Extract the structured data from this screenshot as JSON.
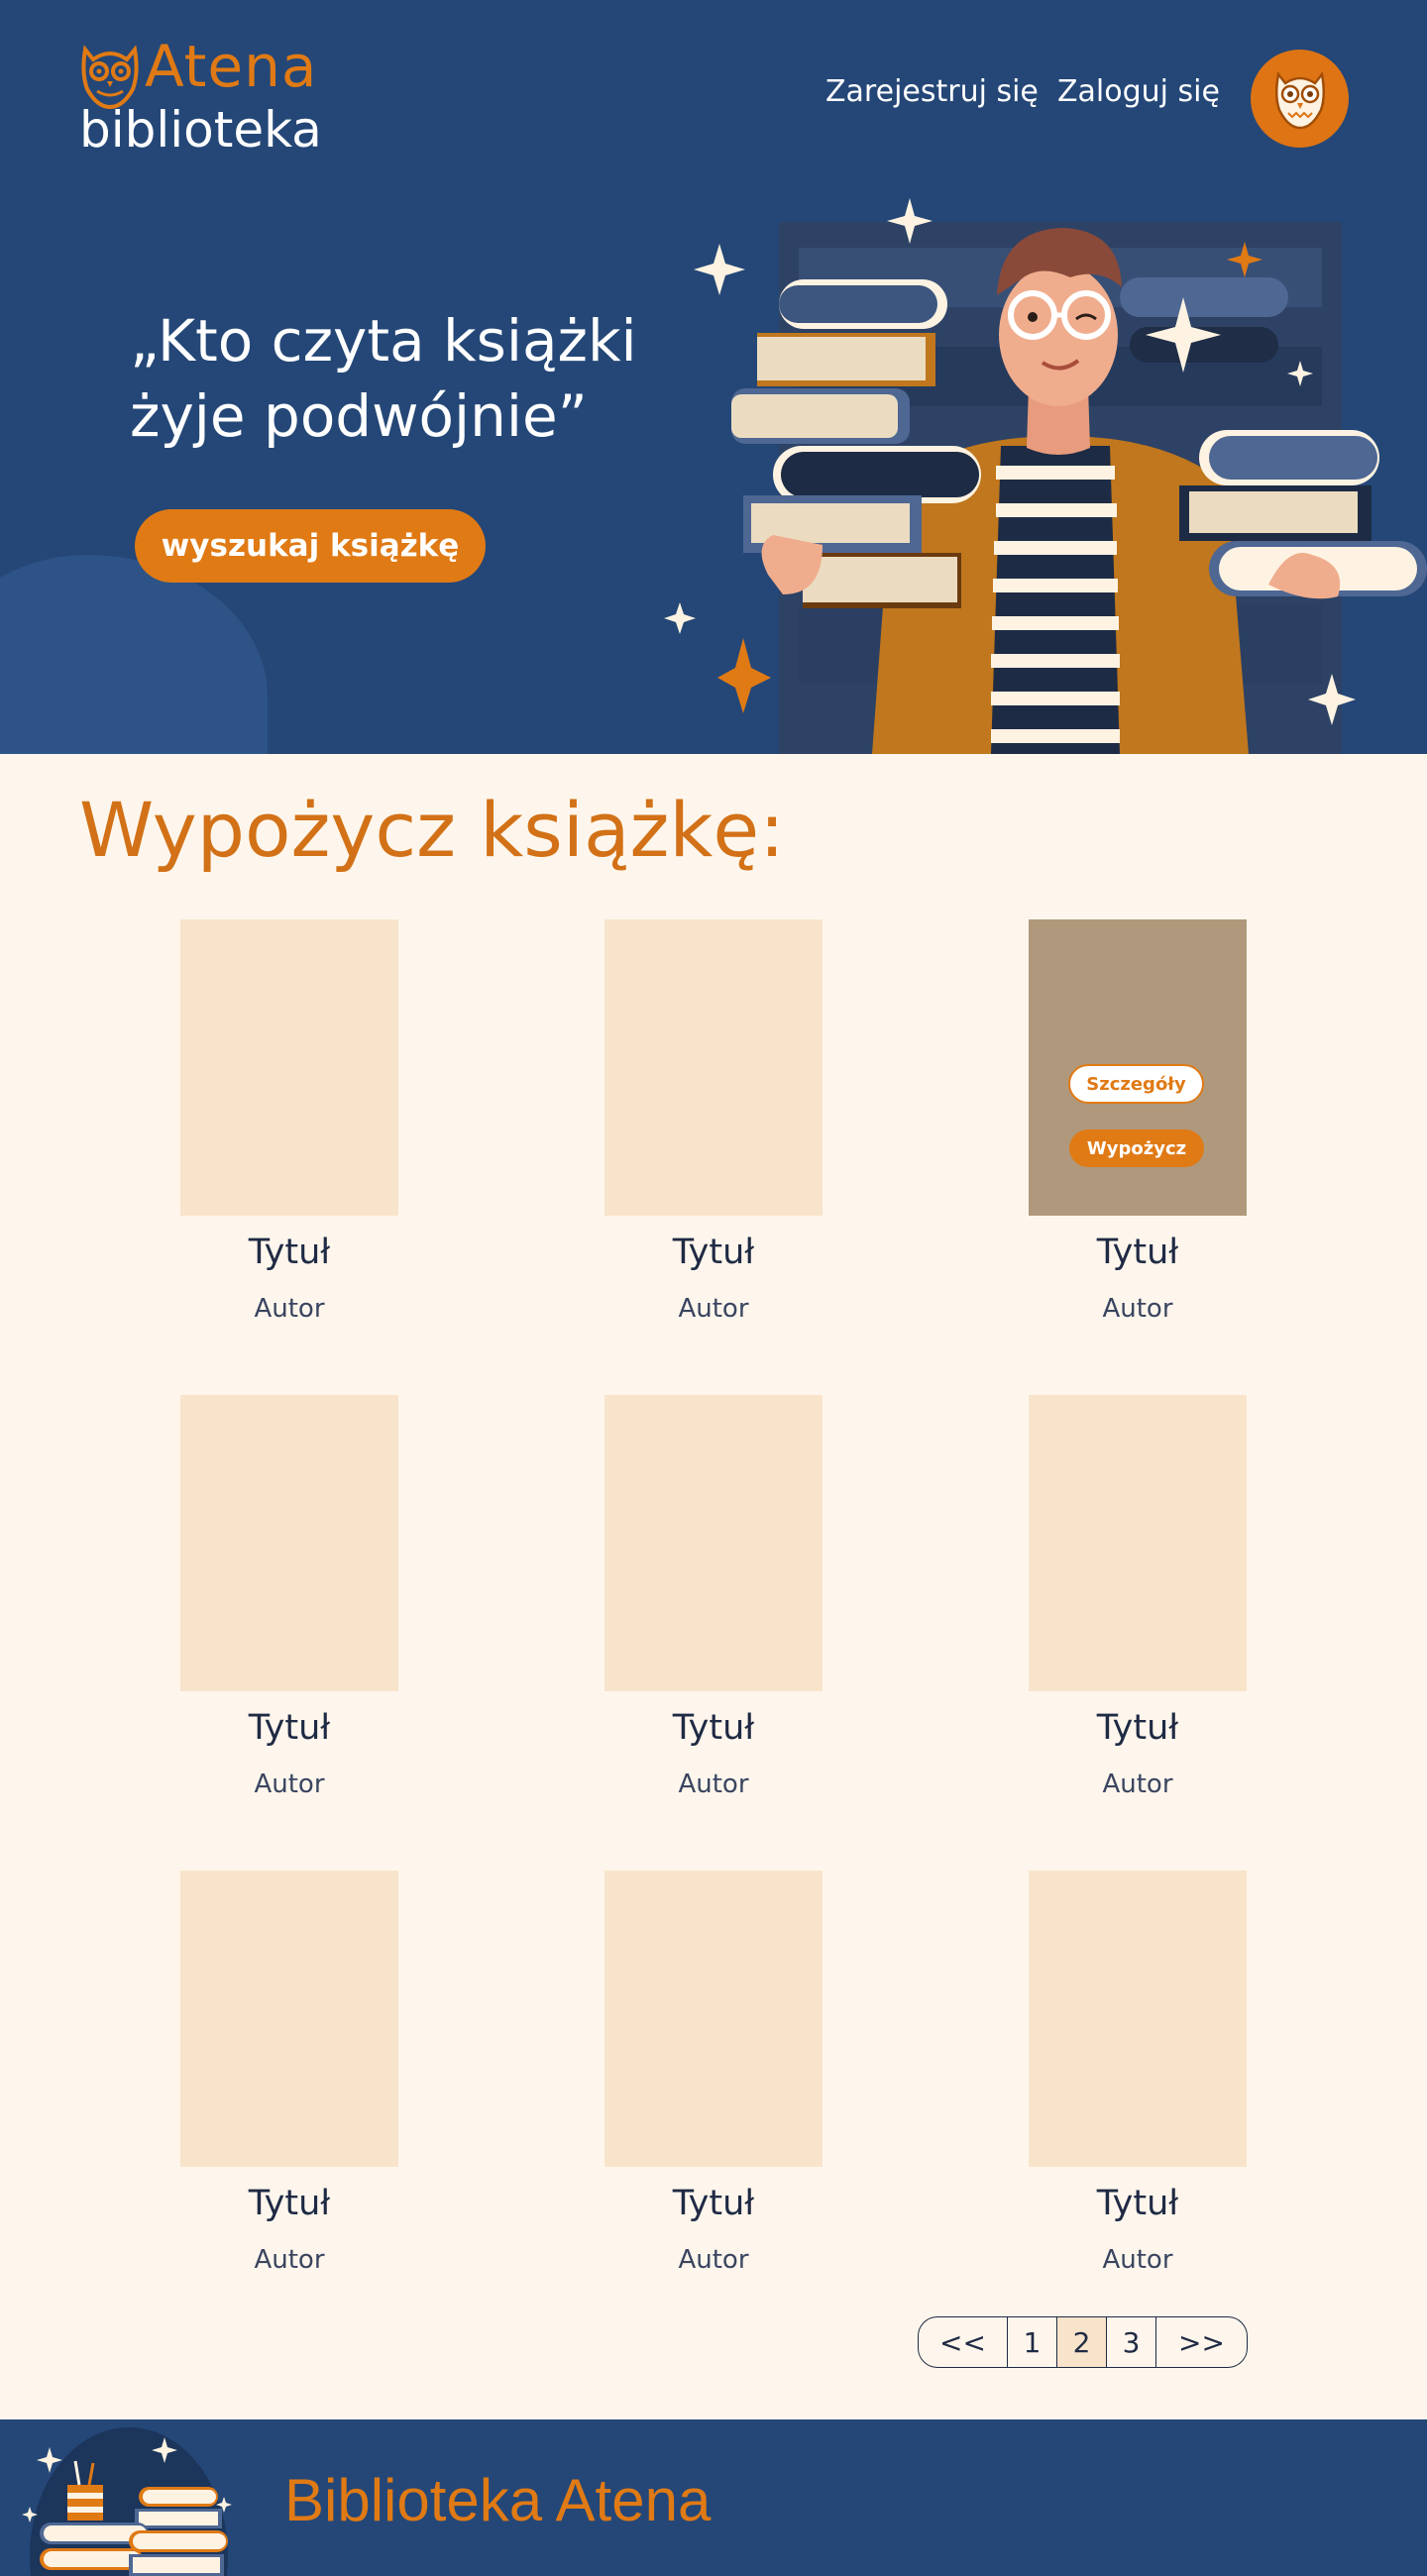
{
  "header": {
    "logo_top": "Atena",
    "logo_bottom": "biblioteka",
    "nav_register": "Zarejestruj się",
    "nav_login": "Zaloguj się",
    "avatar_icon": "owl-icon"
  },
  "hero": {
    "quote_line1": "„Kto czyta książki",
    "quote_line2": "żyje podwójnie”",
    "search_button": "wyszukaj książkę"
  },
  "main": {
    "title": "Wypożycz książkę:",
    "books": [
      {
        "title": "Tytuł",
        "author": "Autor"
      },
      {
        "title": "Tytuł",
        "author": "Autor"
      },
      {
        "title": "Tytuł",
        "author": "Autor",
        "details_label": "Szczegóły",
        "borrow_label": "Wypożycz"
      },
      {
        "title": "Tytuł",
        "author": "Autor"
      },
      {
        "title": "Tytuł",
        "author": "Autor"
      },
      {
        "title": "Tytuł",
        "author": "Autor"
      },
      {
        "title": "Tytuł",
        "author": "Autor"
      },
      {
        "title": "Tytuł",
        "author": "Autor"
      },
      {
        "title": "Tytuł",
        "author": "Autor"
      }
    ]
  },
  "pagination": {
    "prev": "<<",
    "pages": [
      "1",
      "2",
      "3"
    ],
    "current": "2",
    "next": ">>"
  },
  "footer": {
    "title": "Biblioteka Atena"
  },
  "colors": {
    "navy": "#244777",
    "orange": "#e07a15",
    "cream": "#fef6ec",
    "cover": "#f8e4cb",
    "cover_hover": "#af987c"
  }
}
